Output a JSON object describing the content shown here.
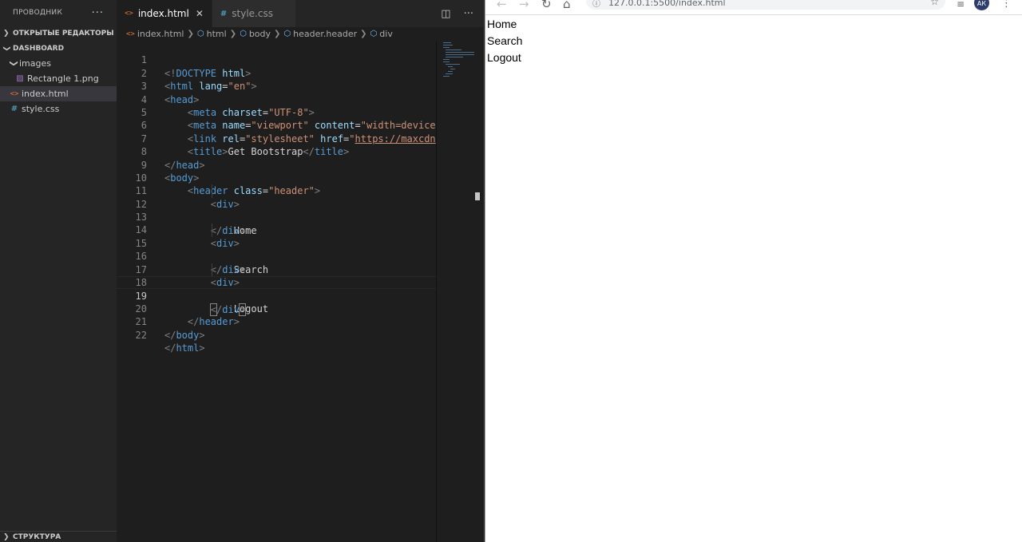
{
  "explorer": {
    "title": "ПРОВОДНИК",
    "more": "···",
    "open_editors_label": "ОТКРЫТЫЕ РЕДАКТОРЫ",
    "project_label": "DASHBOARD",
    "folder_images": "images",
    "file_rectangle": "Rectangle 1.png",
    "file_index": "index.html",
    "file_style": "style.css",
    "outline_label": "СТРУКТУРА"
  },
  "tabs": [
    {
      "label": "index.html",
      "icon": "html-file-icon",
      "active": true
    },
    {
      "label": "style.css",
      "icon": "css-file-icon",
      "active": false
    }
  ],
  "breadcrumb": [
    "index.html",
    "html",
    "body",
    "header.header",
    "div"
  ],
  "code": {
    "line_numbers": [
      "1",
      "2",
      "3",
      "4",
      "5",
      "6",
      "7",
      "8",
      "9",
      "10",
      "11",
      "12",
      "13",
      "14",
      "15",
      "16",
      "17",
      "18",
      "19",
      "20",
      "21",
      "22"
    ],
    "doctype": "<!DOCTYPE html>",
    "html_open_tag": "html",
    "lang_attr": "lang",
    "lang_val": "\"en\"",
    "head": "head",
    "meta": "meta",
    "charset_attr": "charset",
    "charset_val": "\"UTF-8\"",
    "name_attr": "name",
    "name_val": "\"viewport\"",
    "content_attr": "content",
    "content_val": "\"width=device",
    "link": "link",
    "rel_attr": "rel",
    "rel_val": "\"stylesheet\"",
    "href_attr": "href",
    "href_q": "\"",
    "href_val": "https://maxcdn",
    "title_tag": "title",
    "title_text": "Get Bootstrap",
    "body": "body",
    "header": "header",
    "class_attr": "class",
    "class_val": "\"header\"",
    "div": "div",
    "home": "Home",
    "search": "Search",
    "logout": "Logout"
  },
  "browser": {
    "url": "127.0.0.1:5500/index.html",
    "avatar_initials": "АК",
    "items": [
      "Home",
      "Search",
      "Logout"
    ]
  }
}
